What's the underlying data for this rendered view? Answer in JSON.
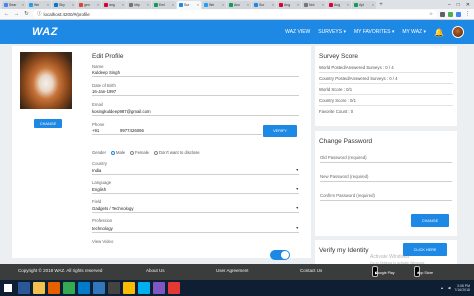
{
  "browser": {
    "tabs": [
      {
        "label": "Sear",
        "color": "#4285f4"
      },
      {
        "label": "We",
        "color": "#1da1f2"
      },
      {
        "label": "Sky",
        "color": "#0078d4"
      },
      {
        "label": "gen",
        "color": "#db4437"
      },
      {
        "label": "ang",
        "color": "#dd0031"
      },
      {
        "label": "http",
        "color": "#757575"
      },
      {
        "label": "Emi",
        "color": "#0f9d58"
      },
      {
        "label": "Sur",
        "color": "#1e88e5"
      },
      {
        "label": "We",
        "color": "#1da1f2"
      },
      {
        "label": "Anc",
        "color": "#0f9d58"
      },
      {
        "label": "Sur",
        "color": "#1e88e5"
      },
      {
        "label": "Ang",
        "color": "#dd0031"
      },
      {
        "label": "Not",
        "color": "#757575"
      },
      {
        "label": "Ang",
        "color": "#dd0031"
      },
      {
        "label": "Apl",
        "color": "#0f9d58"
      }
    ],
    "new_tab_glyph": "+",
    "url": "localhost:4200/#/profile",
    "window_buttons": [
      "–",
      "□",
      "✕"
    ]
  },
  "header": {
    "logo": "WAZ",
    "nav": [
      "WAZ VIEW",
      "SURVEYS ▾",
      "MY FAVORITES ▾",
      "MY WAZ ▾"
    ],
    "bell_glyph": "🔔"
  },
  "profile": {
    "title": "Edit Profile",
    "change_photo_label": "CHANGE",
    "name_label": "Name",
    "name_value": "Kuldeep Singh",
    "dob_label": "Date of Birth",
    "dob_value": "16-Jan-1997",
    "email_label": "Email",
    "email_value": "kosingkuldeep987@gmail.com",
    "phone_label": "Phone",
    "phone_code": "+91",
    "phone_value": "9977426066",
    "verify_label": "VERIFY",
    "gender_label": "Gender",
    "gender_options": [
      "Male",
      "Female",
      "Don't want to disclose"
    ],
    "gender_selected": "Male",
    "country_label": "Country",
    "country_value": "India",
    "language_label": "Language",
    "language_value": "English",
    "field_label": "Field",
    "field_value": "Gadgets / Technology",
    "profession_label": "Profession",
    "profession_value": "technology",
    "view_video_label": "View Video",
    "view_video_on": true
  },
  "survey_score": {
    "title": "Survey Score",
    "rows": [
      "World Posted/Answered Surveys : 0 / 4",
      "Country Posted/Answered Surveys : 0 / 4",
      "World Score : 0/1",
      "Country Score : 0/1",
      "Favorite Count : 0"
    ]
  },
  "change_password": {
    "title": "Change Password",
    "old_placeholder": "Old Password (required)",
    "new_placeholder": "New Password (required)",
    "confirm_placeholder": "Confirm Password (required)",
    "button_label": "CHANGE"
  },
  "identity": {
    "title": "Verify my Identity",
    "button_label": "CLICK HERE"
  },
  "footer": {
    "copyright": "Copyright © 2018 WAZ. All rights reserved",
    "about": "About Us",
    "agreement": "User Agreement",
    "contact": "Contact Us",
    "google_play": "Google Play",
    "app_store": "App Store"
  },
  "watermark": {
    "line1": "Activate Windows",
    "line2": "Go to Settings to activate Windows."
  },
  "taskbar": {
    "icons": [
      {
        "name": "task-view-icon",
        "color": "#2b5797"
      },
      {
        "name": "file-explorer-icon",
        "color": "#f2c14e"
      },
      {
        "name": "firefox-icon",
        "color": "#e66000"
      },
      {
        "name": "chrome-icon",
        "color": "#34a853"
      },
      {
        "name": "vscode-icon",
        "color": "#007acc"
      },
      {
        "name": "edge-icon",
        "color": "#3277bc"
      },
      {
        "name": "terminal-icon",
        "color": "#444444"
      },
      {
        "name": "chrome-icon-2",
        "color": "#fbbc05"
      },
      {
        "name": "skype-icon",
        "color": "#00aff0"
      },
      {
        "name": "app-icon",
        "color": "#7e57c2"
      },
      {
        "name": "app-icon-2",
        "color": "#e53935"
      }
    ],
    "time": "3:08 PM",
    "date": "7/16/2018"
  }
}
